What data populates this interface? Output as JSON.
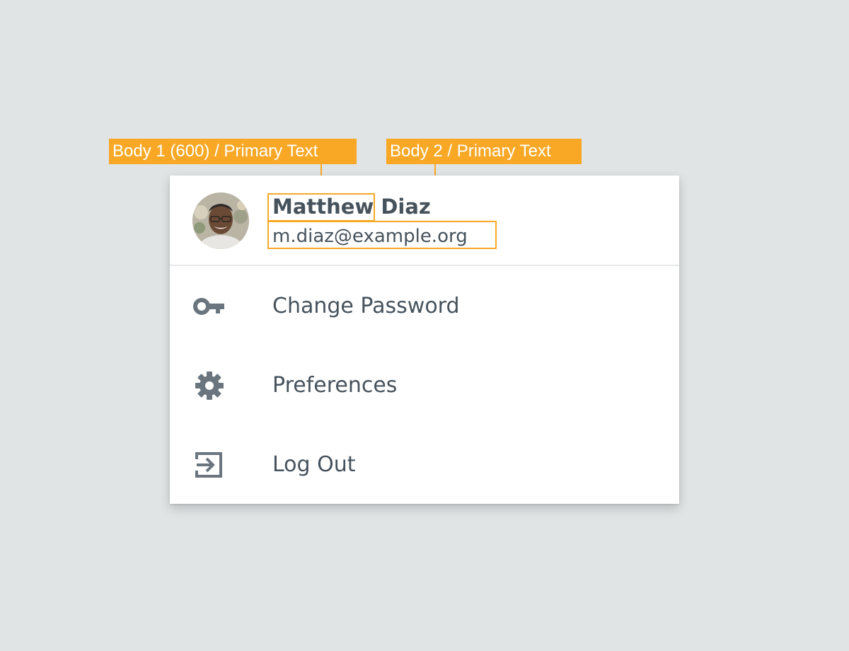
{
  "annotations": {
    "name_spec": "Body 1 (600) / Primary Text",
    "email_spec": "Body 2 / Primary Text",
    "color": "#f9a825"
  },
  "user": {
    "name": "Matthew Diaz",
    "email": "m.diaz@example.org",
    "avatar_icon": "user-photo"
  },
  "menu": {
    "items": [
      {
        "label": "Change Password",
        "icon": "key-icon"
      },
      {
        "label": "Preferences",
        "icon": "gear-icon"
      },
      {
        "label": "Log Out",
        "icon": "logout-icon"
      }
    ]
  },
  "colors": {
    "background": "#e0e4e5",
    "text_primary": "#46525c",
    "icon": "#6a757e",
    "divider": "#e6e8ea"
  }
}
